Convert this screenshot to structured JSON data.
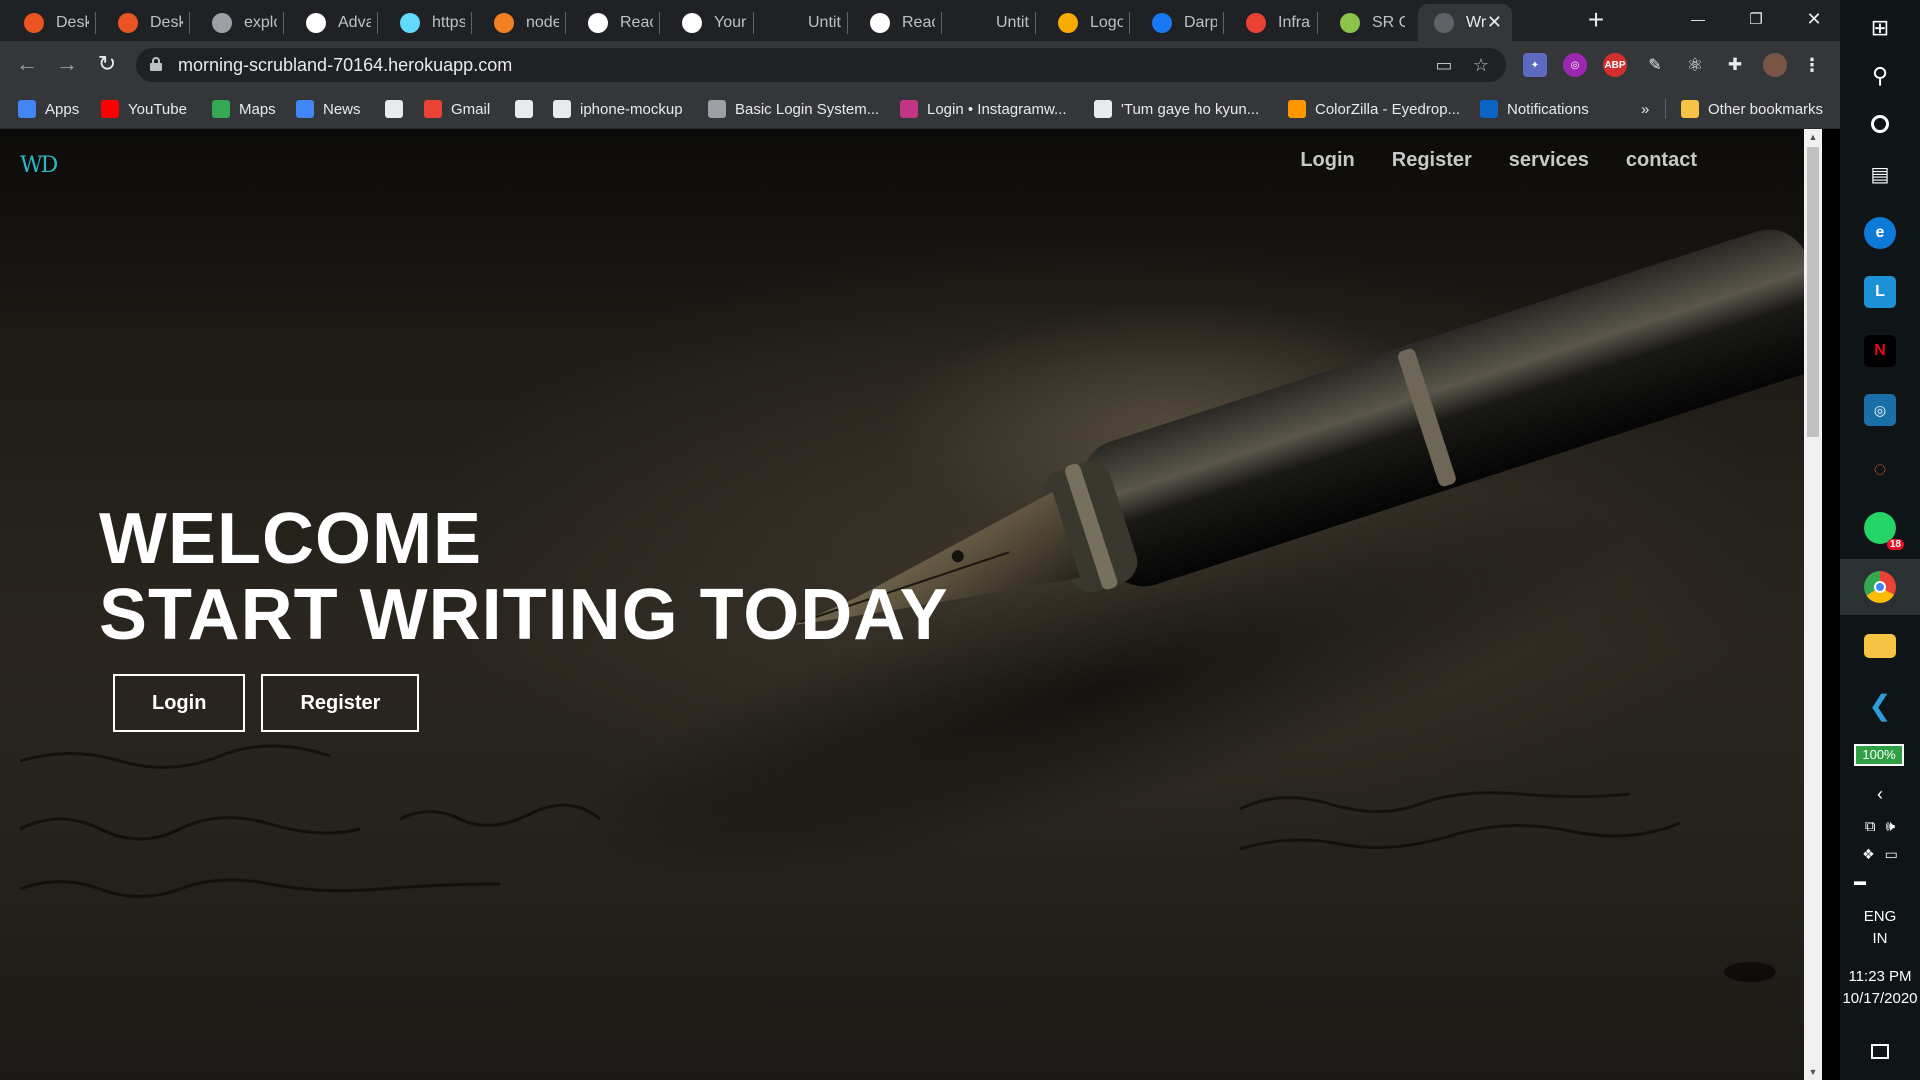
{
  "tabs": [
    {
      "label": "Deskto",
      "icon": "ubuntu-icon",
      "color": "#e95420"
    },
    {
      "label": "Deskto",
      "icon": "ubuntu-icon",
      "color": "#e95420"
    },
    {
      "label": "explora",
      "icon": "loading-icon",
      "color": "#9aa0a6"
    },
    {
      "label": "Advanc",
      "icon": "github-icon",
      "color": "#ffffff"
    },
    {
      "label": "https:/",
      "icon": "react-icon",
      "color": "#61dafb"
    },
    {
      "label": "node.js",
      "icon": "stackoverflow-icon",
      "color": "#f48024"
    },
    {
      "label": "Reactif",
      "icon": "bookmark-page-icon",
      "color": "#ffffff"
    },
    {
      "label": "Your Re",
      "icon": "github-icon",
      "color": "#ffffff"
    },
    {
      "label": "Untitle",
      "icon": "blank-page-icon",
      "color": "#202124"
    },
    {
      "label": "Reactif",
      "icon": "bookmark-page-icon",
      "color": "#ffffff"
    },
    {
      "label": "Untitle",
      "icon": "blank-page-icon",
      "color": "#202124"
    },
    {
      "label": "Logo M",
      "icon": "logo-maker-icon",
      "color": "#f9ab00"
    },
    {
      "label": "Darpar",
      "icon": "facebook-icon",
      "color": "#1877f2"
    },
    {
      "label": "Infrastr",
      "icon": "gmail-icon",
      "color": "#ea4335"
    },
    {
      "label": "SR Gro",
      "icon": "sr-group-icon",
      "color": "#8bc34a"
    },
    {
      "label": "Wri",
      "icon": "globe-icon",
      "color": "#5f6368",
      "active": true
    }
  ],
  "window_controls": {
    "minimize": "—",
    "restore": "❐",
    "close": "✕",
    "new_tab": "+"
  },
  "address_bar": {
    "url": "morning-scrubland-70164.herokuapp.com"
  },
  "bookmarks": [
    {
      "label": "Apps",
      "icon": "apps-grid-icon",
      "color": "#4285f4"
    },
    {
      "label": "YouTube",
      "icon": "youtube-icon",
      "color": "#ff0000"
    },
    {
      "label": "Maps",
      "icon": "maps-icon",
      "color": "#34a853"
    },
    {
      "label": "News",
      "icon": "news-icon",
      "color": "#4285f4"
    },
    {
      "label": "",
      "icon": "globe-icon",
      "color": "#e8eaed"
    },
    {
      "label": "Gmail",
      "icon": "gmail-icon",
      "color": "#ea4335"
    },
    {
      "label": "",
      "icon": "github-icon",
      "color": "#e8eaed"
    },
    {
      "label": "iphone-mockup",
      "icon": "globe-icon",
      "color": "#e8eaed"
    },
    {
      "label": "Basic Login System...",
      "icon": "code-icon",
      "color": "#9aa0a6"
    },
    {
      "label": "Login • Instagramw...",
      "icon": "instagram-icon",
      "color": "#c13584"
    },
    {
      "label": "'Tum gaye ho kyun...",
      "icon": "globe-icon",
      "color": "#e8eaed"
    },
    {
      "label": "ColorZilla - Eyedrop...",
      "icon": "colorzilla-icon",
      "color": "#ff9800"
    },
    {
      "label": "Notifications",
      "icon": "linkedin-icon",
      "color": "#0a66c2"
    }
  ],
  "bookmarks_overflow": "»",
  "other_bookmarks": "Other bookmarks",
  "site": {
    "logo": "WD",
    "nav": [
      "Login",
      "Register",
      "services",
      "contact"
    ],
    "hero_line1": "WELCOME",
    "hero_line2": "START WRITING TODAY",
    "buttons": {
      "login": "Login",
      "register": "Register"
    }
  },
  "taskbar": {
    "badge_count": "18",
    "battery": "100%",
    "battery_level": 1.0,
    "language": "ENG",
    "region": "IN",
    "time": "11:23 PM",
    "date": "10/17/2020"
  },
  "colors": {
    "chrome_bg": "#202124",
    "toolbar_bg": "#35363a",
    "brand_accent": "#2fb7c9",
    "taskbar_bg": "#0f1416"
  }
}
